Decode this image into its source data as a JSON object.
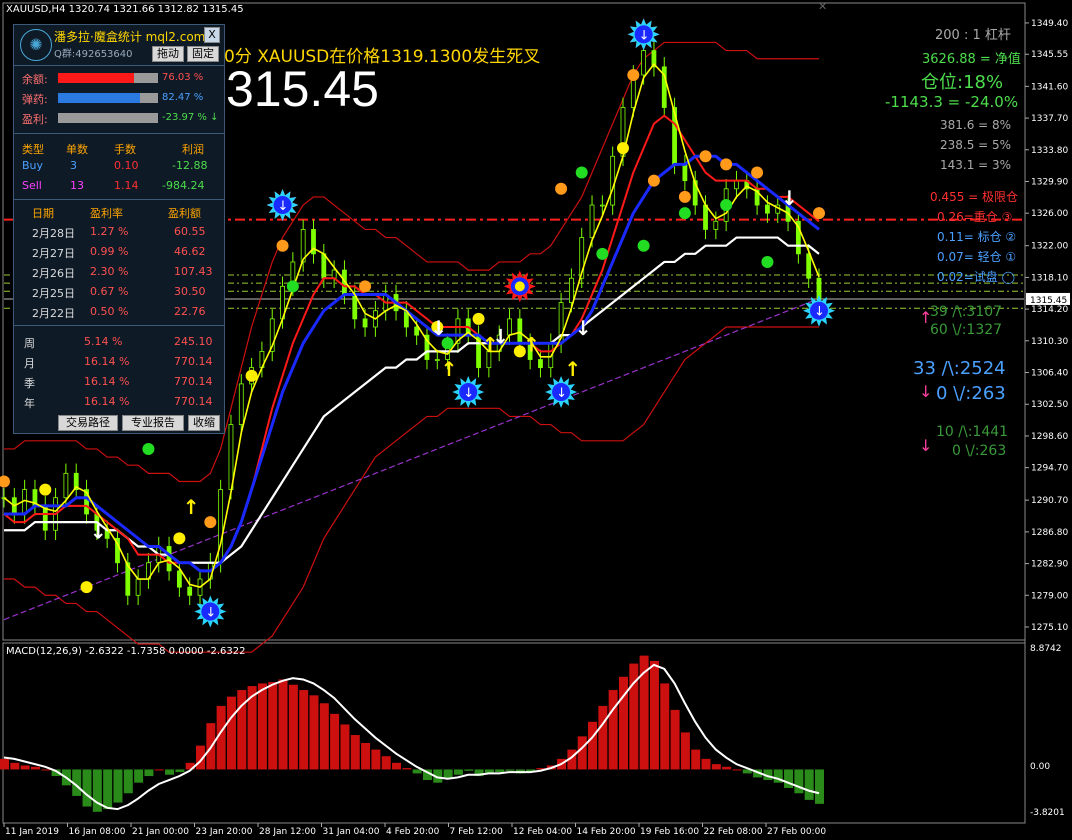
{
  "window": {
    "title": "XAUUSD,H4  1320.74 1321.66 1312.82 1315.45",
    "close_label": "✕"
  },
  "banner": {
    "alert": "0分 XAUUSD在价格1319.1300发生死叉",
    "big_price": "315.45"
  },
  "panel": {
    "brand": "潘多拉·魔盒统计 mql2.com",
    "close": "X",
    "account": "Q群:492653640",
    "drag_btn": "拖动",
    "fix_btn": "固定",
    "balance_label": "余额:",
    "balance_pct": "76.03 %",
    "balance_fill": 0.76,
    "ammo_label": "弹药:",
    "ammo_pct": "82.47 %",
    "ammo_fill": 0.82,
    "profit_label": "盈利:",
    "profit_pct": "-23.97 % ↓",
    "orders_header": [
      "类型",
      "单数",
      "手数",
      "利润"
    ],
    "buy": [
      "Buy",
      "3",
      "0.10",
      "-12.88"
    ],
    "sell": [
      "Sell",
      "13",
      "1.14",
      "-984.24"
    ],
    "daily_header": [
      "日期",
      "盈利率",
      "盈利额"
    ],
    "daily": [
      [
        "2月28日",
        "1.27 %",
        "60.55"
      ],
      [
        "2月27日",
        "0.99 %",
        "46.62"
      ],
      [
        "2月26日",
        "2.30 %",
        "107.43"
      ],
      [
        "2月25日",
        "0.67 %",
        "30.50"
      ],
      [
        "2月22日",
        "0.50 %",
        "22.76"
      ]
    ],
    "period": [
      [
        "周",
        "5.14 %",
        "245.10"
      ],
      [
        "月",
        "16.14 %",
        "770.14"
      ],
      [
        "季",
        "16.14 %",
        "770.14"
      ],
      [
        "年",
        "16.14 %",
        "770.14"
      ]
    ],
    "btn_path": "交易路径",
    "btn_report": "专业报告",
    "btn_collapse": "收缩"
  },
  "right_info": {
    "leverage": "200 : 1  杠杆",
    "equity": "3626.88 = 净值",
    "position": "仓位:18%",
    "pnl": "-1143.3 = -24.0%",
    "r1": "381.6 = 8%",
    "r2": "238.5 = 5%",
    "r3": "143.1 = 3%",
    "lv1": "0.455 = 极限仓",
    "lv2": "0.26=重仓 ③",
    "lv3": "0.11= 标仓 ②",
    "lv4": "0.07= 轻仓 ①",
    "lv5": "0.02=试盘 ◯",
    "s1a": "39 /\\:3107",
    "s1b": "60 \\/:1327",
    "s2a": "33 /\\:2524",
    "s2b": "0 \\/:263",
    "s3a": "10 /\\:1441",
    "s3b": "0 \\/:263"
  },
  "macd": {
    "label": "MACD(12,26,9) -2.6322 -1.7358 0.0000 -2.6322",
    "axis_top": "8.8742",
    "axis_zero": "0.00",
    "axis_bottom": "-3.8201"
  },
  "current_price_tag": "1315.45",
  "chart_data": {
    "type": "line",
    "title": "XAUUSD,H4",
    "y_ticks": [
      "1349.40",
      "1345.55",
      "1341.60",
      "1337.70",
      "1333.80",
      "1329.90",
      "1326.00",
      "1322.00",
      "1318.10",
      "1314.20",
      "1310.30",
      "1306.40",
      "1302.50",
      "1298.60",
      "1294.70",
      "1290.70",
      "1286.80",
      "1282.90",
      "1279.00",
      "1275.10"
    ],
    "ylim": [
      1273.5,
      1350.5
    ],
    "x_ticks": [
      "11 Jan 2019",
      "16 Jan 08:00",
      "21 Jan 00:00",
      "23 Jan 20:00",
      "28 Jan 12:00",
      "31 Jan 04:00",
      "4 Feb 20:00",
      "7 Feb 12:00",
      "12 Feb 04:00",
      "14 Feb 20:00",
      "19 Feb 16:00",
      "22 Feb 08:00",
      "27 Feb 00:00"
    ],
    "price_close": [
      1291,
      1289,
      1292,
      1290,
      1287,
      1291,
      1294,
      1292,
      1289,
      1287,
      1286,
      1283,
      1279,
      1281,
      1283,
      1285,
      1282,
      1280,
      1279,
      1281,
      1283,
      1292,
      1300,
      1305,
      1307,
      1309,
      1313,
      1317,
      1320,
      1324,
      1321,
      1318,
      1319,
      1316,
      1313,
      1312,
      1314,
      1316,
      1314,
      1312,
      1311,
      1308,
      1308,
      1310,
      1313,
      1311,
      1307,
      1309,
      1311,
      1313,
      1310,
      1308,
      1307,
      1310,
      1315,
      1318,
      1323,
      1327,
      1327,
      1333,
      1339,
      1343,
      1346,
      1344,
      1339,
      1332,
      1330,
      1327,
      1324,
      1325,
      1329,
      1330,
      1329,
      1327,
      1326,
      1327,
      1325,
      1321,
      1318,
      1315.45
    ],
    "ma_red": [
      1289,
      1288,
      1288,
      1289,
      1289,
      1289,
      1290,
      1290,
      1290,
      1289,
      1288,
      1287,
      1286,
      1284,
      1284,
      1284,
      1283,
      1283,
      1283,
      1282,
      1282,
      1283,
      1285,
      1288,
      1292,
      1297,
      1302,
      1306,
      1310,
      1313,
      1316,
      1318,
      1318,
      1317,
      1317,
      1316,
      1316,
      1315,
      1315,
      1315,
      1314,
      1313,
      1312,
      1312,
      1312,
      1312,
      1311,
      1310,
      1310,
      1310,
      1310,
      1310,
      1309,
      1309,
      1310,
      1311,
      1313,
      1316,
      1319,
      1323,
      1327,
      1331,
      1334,
      1337,
      1338,
      1337,
      1335,
      1333,
      1331,
      1330,
      1330,
      1330,
      1330,
      1329,
      1329,
      1328,
      1328,
      1327,
      1326,
      1325
    ],
    "ma_blue": [
      1289,
      1289,
      1289,
      1290,
      1290,
      1290,
      1290,
      1291,
      1291,
      1290,
      1289,
      1288,
      1287,
      1286,
      1285,
      1285,
      1284,
      1283,
      1283,
      1282,
      1282,
      1283,
      1285,
      1288,
      1292,
      1296,
      1300,
      1304,
      1307,
      1310,
      1312,
      1314,
      1315,
      1316,
      1316,
      1316,
      1316,
      1316,
      1315,
      1314,
      1313,
      1312,
      1311,
      1311,
      1311,
      1311,
      1311,
      1310,
      1310,
      1310,
      1310,
      1310,
      1310,
      1310,
      1310,
      1311,
      1312,
      1314,
      1317,
      1320,
      1323,
      1326,
      1328,
      1330,
      1331,
      1332,
      1332,
      1333,
      1333,
      1333,
      1332,
      1332,
      1331,
      1330,
      1329,
      1328,
      1327,
      1326,
      1325,
      1324
    ],
    "ma_white": [
      1287,
      1287,
      1287,
      1288,
      1288,
      1288,
      1288,
      1288,
      1288,
      1288,
      1287,
      1287,
      1286,
      1285,
      1285,
      1284,
      1284,
      1283,
      1283,
      1283,
      1283,
      1283,
      1284,
      1285,
      1287,
      1289,
      1291,
      1293,
      1295,
      1297,
      1299,
      1301,
      1302,
      1303,
      1304,
      1305,
      1306,
      1307,
      1307,
      1308,
      1308,
      1309,
      1309,
      1309,
      1309,
      1310,
      1310,
      1310,
      1310,
      1310,
      1310,
      1310,
      1310,
      1310,
      1311,
      1311,
      1312,
      1313,
      1314,
      1315,
      1316,
      1317,
      1318,
      1319,
      1320,
      1320,
      1321,
      1321,
      1322,
      1322,
      1322,
      1323,
      1323,
      1323,
      1323,
      1323,
      1322,
      1322,
      1322,
      1321
    ],
    "ma_purple": [
      1276,
      1276.5,
      1277,
      1277.5,
      1278,
      1278.5,
      1279,
      1279.5,
      1280,
      1280.5,
      1281,
      1281.5,
      1282,
      1282.5,
      1283,
      1283.5,
      1284,
      1284.5,
      1285,
      1285.5,
      1286,
      1286.5,
      1287,
      1287.5,
      1288,
      1288.5,
      1289,
      1289.5,
      1290,
      1290.5,
      1291,
      1291.5,
      1292,
      1292.5,
      1293,
      1293.5,
      1294,
      1294.5,
      1295,
      1295.5,
      1296,
      1296.5,
      1297,
      1297.5,
      1298,
      1298.5,
      1299,
      1299.5,
      1300,
      1300.5,
      1301,
      1301.5,
      1302,
      1302.5,
      1303,
      1303.5,
      1304,
      1304.5,
      1305,
      1305.5,
      1306,
      1306.5,
      1307,
      1307.5,
      1308,
      1308.5,
      1309,
      1309.5,
      1310,
      1310.5,
      1311,
      1311.5,
      1312,
      1312.5,
      1313,
      1313.5,
      1314,
      1314.5,
      1315,
      1315.5
    ],
    "band_upper": [
      1297,
      1297,
      1298,
      1298,
      1298,
      1298,
      1298,
      1298,
      1297,
      1297,
      1296,
      1296,
      1295,
      1295,
      1294,
      1294,
      1294,
      1293,
      1293,
      1293,
      1294,
      1297,
      1302,
      1307,
      1312,
      1316,
      1320,
      1323,
      1325,
      1327,
      1328,
      1328,
      1327,
      1326,
      1325,
      1324,
      1324,
      1323,
      1323,
      1322,
      1321,
      1320,
      1320,
      1320,
      1320,
      1319,
      1319,
      1319,
      1320,
      1320,
      1320,
      1321,
      1321,
      1322,
      1324,
      1326,
      1328,
      1331,
      1334,
      1337,
      1340,
      1343,
      1345,
      1346,
      1347,
      1347,
      1347,
      1347,
      1347,
      1347,
      1346,
      1346,
      1346,
      1345,
      1345,
      1345,
      1345,
      1345,
      1345,
      1345
    ],
    "band_lower": [
      1281,
      1281,
      1280,
      1280,
      1279,
      1279,
      1278,
      1278,
      1277,
      1277,
      1276,
      1275,
      1274,
      1273,
      1273,
      1273,
      1272,
      1272,
      1272,
      1272,
      1272,
      1272,
      1272,
      1272,
      1272,
      1273,
      1274,
      1276,
      1278,
      1280,
      1283,
      1286,
      1288,
      1290,
      1292,
      1294,
      1296,
      1297,
      1298,
      1299,
      1300,
      1301,
      1301,
      1302,
      1302,
      1302,
      1302,
      1302,
      1302,
      1301,
      1301,
      1301,
      1300,
      1300,
      1299,
      1299,
      1298,
      1298,
      1298,
      1298,
      1298,
      1299,
      1300,
      1302,
      1304,
      1306,
      1308,
      1309,
      1310,
      1311,
      1312,
      1312,
      1312,
      1312,
      1312,
      1312,
      1312,
      1312,
      1312,
      1312
    ],
    "h_levels": [
      {
        "name": "极限仓",
        "price": 1325.2,
        "color": "#ff2020"
      },
      {
        "name": "重仓",
        "price": 1318.4,
        "color": "#9acd32"
      },
      {
        "name": "标仓",
        "price": 1317.4,
        "color": "#9acd32"
      },
      {
        "name": "轻仓",
        "price": 1316.4,
        "color": "#9acd32"
      },
      {
        "name": "试盘",
        "price": 1314.3,
        "color": "#9acd32"
      }
    ],
    "macd_hist": [
      0.8,
      0.5,
      0.3,
      0.2,
      0,
      -0.5,
      -1.2,
      -2.0,
      -2.8,
      -3.2,
      -3.0,
      -2.5,
      -1.8,
      -1.0,
      -0.5,
      0,
      -0.4,
      -0.2,
      0.5,
      1.8,
      3.5,
      4.8,
      5.5,
      6.0,
      6.3,
      6.5,
      6.6,
      6.8,
      6.4,
      6.0,
      5.6,
      5.0,
      4.2,
      3.4,
      2.6,
      2.0,
      1.5,
      1.0,
      0.5,
      0.1,
      -0.3,
      -0.8,
      -1.0,
      -0.7,
      -0.4,
      -0.1,
      -0.5,
      -0.3,
      -0.2,
      -0.1,
      -0.3,
      -0.2,
      0.1,
      0.3,
      0.8,
      1.5,
      2.5,
      3.6,
      4.8,
      6.0,
      7.0,
      8.0,
      8.6,
      8.2,
      6.5,
      4.5,
      2.8,
      1.5,
      0.8,
      0.4,
      0.2,
      0,
      -0.3,
      -0.6,
      -0.8,
      -1.0,
      -1.4,
      -1.8,
      -2.3,
      -2.6
    ],
    "macd_signal": [
      0.9,
      0.8,
      0.6,
      0.4,
      0.2,
      -0.1,
      -0.6,
      -1.2,
      -1.9,
      -2.5,
      -2.9,
      -3.0,
      -2.7,
      -2.2,
      -1.6,
      -1.1,
      -0.8,
      -0.5,
      -0.1,
      0.6,
      1.6,
      2.8,
      3.9,
      4.8,
      5.5,
      6.0,
      6.4,
      6.7,
      6.9,
      6.8,
      6.5,
      6.0,
      5.4,
      4.6,
      3.8,
      3.1,
      2.4,
      1.8,
      1.2,
      0.7,
      0.2,
      -0.2,
      -0.6,
      -0.7,
      -0.6,
      -0.4,
      -0.4,
      -0.3,
      -0.3,
      -0.2,
      -0.2,
      -0.2,
      -0.1,
      0.1,
      0.4,
      0.9,
      1.6,
      2.4,
      3.4,
      4.5,
      5.5,
      6.5,
      7.3,
      7.9,
      7.6,
      6.5,
      5.0,
      3.6,
      2.4,
      1.5,
      0.9,
      0.4,
      0.1,
      -0.2,
      -0.5,
      -0.7,
      -1.0,
      -1.3,
      -1.6,
      -1.8
    ],
    "macd_ylim": [
      -3.8201,
      8.8742
    ],
    "dots_orange": [
      [
        0,
        1293
      ],
      [
        20,
        1288
      ],
      [
        27,
        1322
      ],
      [
        35,
        1317
      ],
      [
        54,
        1329
      ],
      [
        61,
        1343
      ],
      [
        63,
        1330
      ],
      [
        66,
        1328
      ],
      [
        68,
        1333
      ],
      [
        70,
        1332
      ],
      [
        73,
        1331
      ],
      [
        79,
        1326
      ]
    ],
    "dots_yellow": [
      [
        4,
        1292
      ],
      [
        8,
        1280
      ],
      [
        17,
        1286
      ],
      [
        24,
        1306
      ],
      [
        42,
        1312
      ],
      [
        46,
        1313
      ],
      [
        50,
        1309
      ],
      [
        60,
        1334
      ]
    ],
    "dots_green": [
      [
        14,
        1297
      ],
      [
        20,
        1300
      ],
      [
        28,
        1317
      ],
      [
        43,
        1310
      ],
      [
        56,
        1331
      ],
      [
        58,
        1321
      ],
      [
        62,
        1322
      ],
      [
        66,
        1326
      ],
      [
        70,
        1327
      ],
      [
        74,
        1320
      ]
    ],
    "markers_blue_down": [
      [
        20,
        1277
      ],
      [
        27,
        1327
      ],
      [
        45,
        1304
      ],
      [
        54,
        1304
      ],
      [
        62,
        1348
      ],
      [
        79,
        1314
      ]
    ],
    "markers_red_star": [
      [
        27,
        1327
      ],
      [
        50,
        1317
      ],
      [
        62,
        1348
      ]
    ],
    "arrows_yellow_up": [
      [
        18,
        1289
      ],
      [
        43,
        1306
      ],
      [
        47,
        1309
      ],
      [
        51,
        1309
      ],
      [
        55,
        1306
      ]
    ],
    "arrows_white_down": [
      [
        9,
        1286
      ],
      [
        42,
        1311
      ],
      [
        48,
        1310
      ],
      [
        56,
        1311
      ],
      [
        76,
        1327
      ]
    ]
  }
}
